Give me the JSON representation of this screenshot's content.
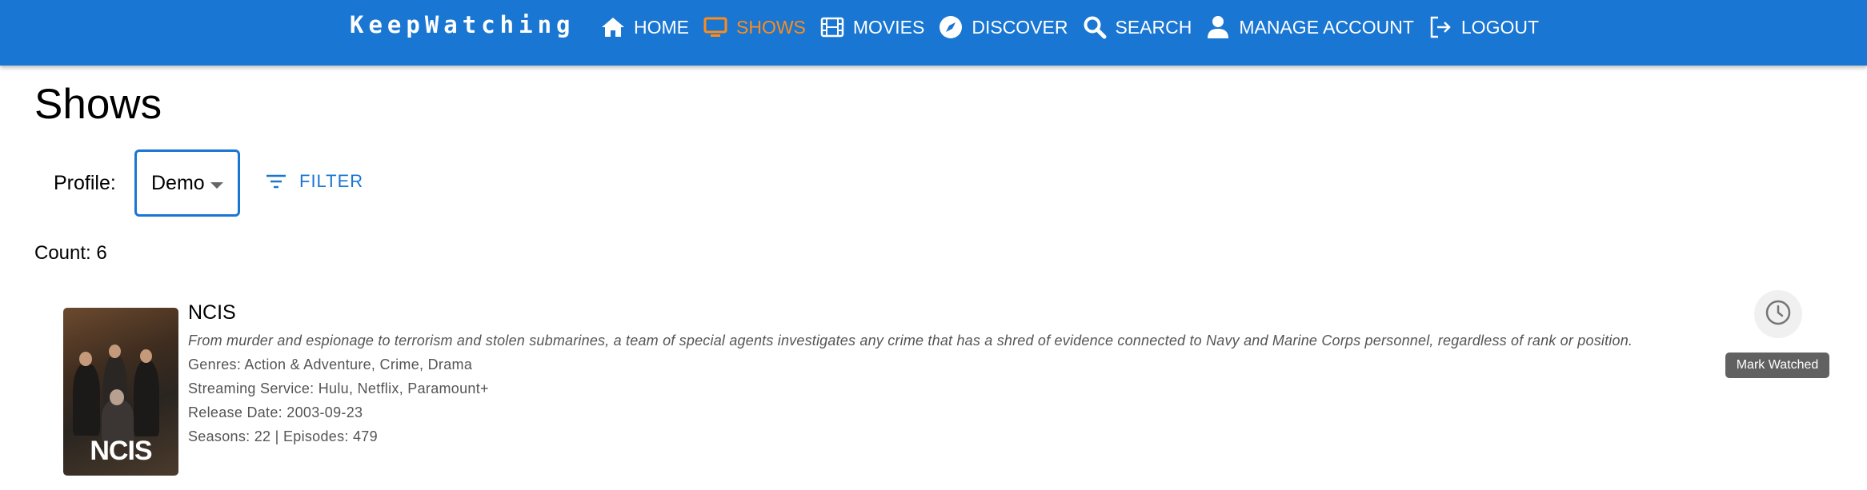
{
  "app": {
    "title": "KeepWatching"
  },
  "nav": {
    "items": [
      {
        "label": "HOME",
        "icon": "home-icon",
        "active": false
      },
      {
        "label": "SHOWS",
        "icon": "tv-icon",
        "active": true
      },
      {
        "label": "MOVIES",
        "icon": "film-icon",
        "active": false
      },
      {
        "label": "DISCOVER",
        "icon": "compass-icon",
        "active": false
      },
      {
        "label": "SEARCH",
        "icon": "search-icon",
        "active": false
      },
      {
        "label": "MANAGE ACCOUNT",
        "icon": "person-icon",
        "active": false
      },
      {
        "label": "LOGOUT",
        "icon": "logout-icon",
        "active": false
      }
    ]
  },
  "page": {
    "title": "Shows"
  },
  "filters": {
    "profile_label": "Profile:",
    "profile_value": "Demo",
    "filter_label": "FILTER"
  },
  "count": {
    "label": "Count: 6"
  },
  "shows": [
    {
      "title": "NCIS",
      "poster_text": "NCIS",
      "overview": "From murder and espionage to terrorism and stolen submarines, a team of special agents investigates any crime that has a shred of evidence connected to Navy and Marine Corps personnel, regardless of rank or position.",
      "genres": "Genres: Action & Adventure, Crime, Drama",
      "streaming": "Streaming Service: Hulu, Netflix, Paramount+",
      "release": "Release Date: 2003-09-23",
      "seasons": "Seasons: 22 | Episodes: 479",
      "watch_tooltip": "Mark Watched"
    }
  ],
  "colors": {
    "appbar": "#1976d2",
    "active_nav": "#ff8c1a",
    "accent": "#1976d2"
  }
}
